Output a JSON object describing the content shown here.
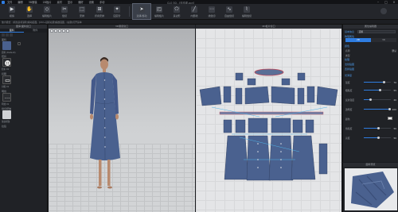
{
  "menubar": {
    "items": [
      "文件",
      "编辑",
      "3D服装",
      "2D板片",
      "素材",
      "显示",
      "偏好",
      "设置",
      "手动"
    ],
    "title": "CLO 3D - [连衣裙.zprj]"
  },
  "toolbar": {
    "tools": [
      {
        "label": "模拟",
        "icon": "simulate-icon"
      },
      {
        "label": "选择",
        "icon": "select-icon"
      },
      {
        "label": "编辑板片",
        "icon": "edit-pattern-icon"
      },
      {
        "label": "缝纫",
        "icon": "sewing-icon"
      },
      {
        "label": "安排",
        "icon": "arrange-icon"
      },
      {
        "label": "折叠安排",
        "icon": "fold-icon"
      },
      {
        "label": "固定针",
        "icon": "pin-icon"
      },
      {
        "label": "选择/移动",
        "icon": "move-icon",
        "active": true
      },
      {
        "label": "编辑板片",
        "icon": "pattern-icon"
      },
      {
        "label": "多边形",
        "icon": "polygon-icon"
      },
      {
        "label": "内部线",
        "icon": "internal-line-icon"
      },
      {
        "label": "线缝纫",
        "icon": "line-sew-icon"
      },
      {
        "label": "自由缝纫",
        "icon": "free-sew-icon"
      },
      {
        "label": "编辑缝纫",
        "icon": "edit-sew-icon"
      }
    ]
  },
  "subbar": {
    "text": "放大模式：[按住鼠标滚轮]拖动画面，[Ctrl+鼠标右键]缩放画面，[右键]打开菜单"
  },
  "left_panel": {
    "title": "图库/面料窗口",
    "tabs": [
      "面料",
      "附件"
    ],
    "sections": [
      "面料",
      "纽扣",
      "扣眼",
      "明线",
      "缝纫褶皱",
      "拉链"
    ],
    "captions": [
      "面料 (Default)",
      "纽扣 01",
      "扣眼 01",
      "明线 01",
      "缝纫褶皱"
    ]
  },
  "view3d": {
    "title": "3D服装窗口"
  },
  "view2d": {
    "title": "2D板片窗口"
  },
  "right_panel": {
    "title": "属性编辑器",
    "fabric_name": "面料",
    "tabs": [
      "2D",
      "3D"
    ],
    "headers": [
      "基本信息",
      "物理属性",
      "颜色",
      "纹理",
      "法线贴图",
      "置换贴图",
      "光泽度"
    ],
    "rows": [
      {
        "k": "名称",
        "v": "默认"
      },
      {
        "k": "类型",
        "v": ""
      },
      {
        "k": "强度",
        "v": "70"
      },
      {
        "k": "粗糙度",
        "v": "55"
      },
      {
        "k": "反射强度",
        "v": "20"
      },
      {
        "k": "透明度",
        "v": "100"
      },
      {
        "k": "颜色",
        "v": ""
      },
      {
        "k": "饱和度",
        "v": "50"
      },
      {
        "k": "亮度",
        "v": "50"
      }
    ]
  },
  "preview": {
    "title": "面料预览"
  },
  "colors": {
    "accent": "#2f7de1",
    "garment": "#4a618f",
    "panel_bg": "#202226"
  }
}
